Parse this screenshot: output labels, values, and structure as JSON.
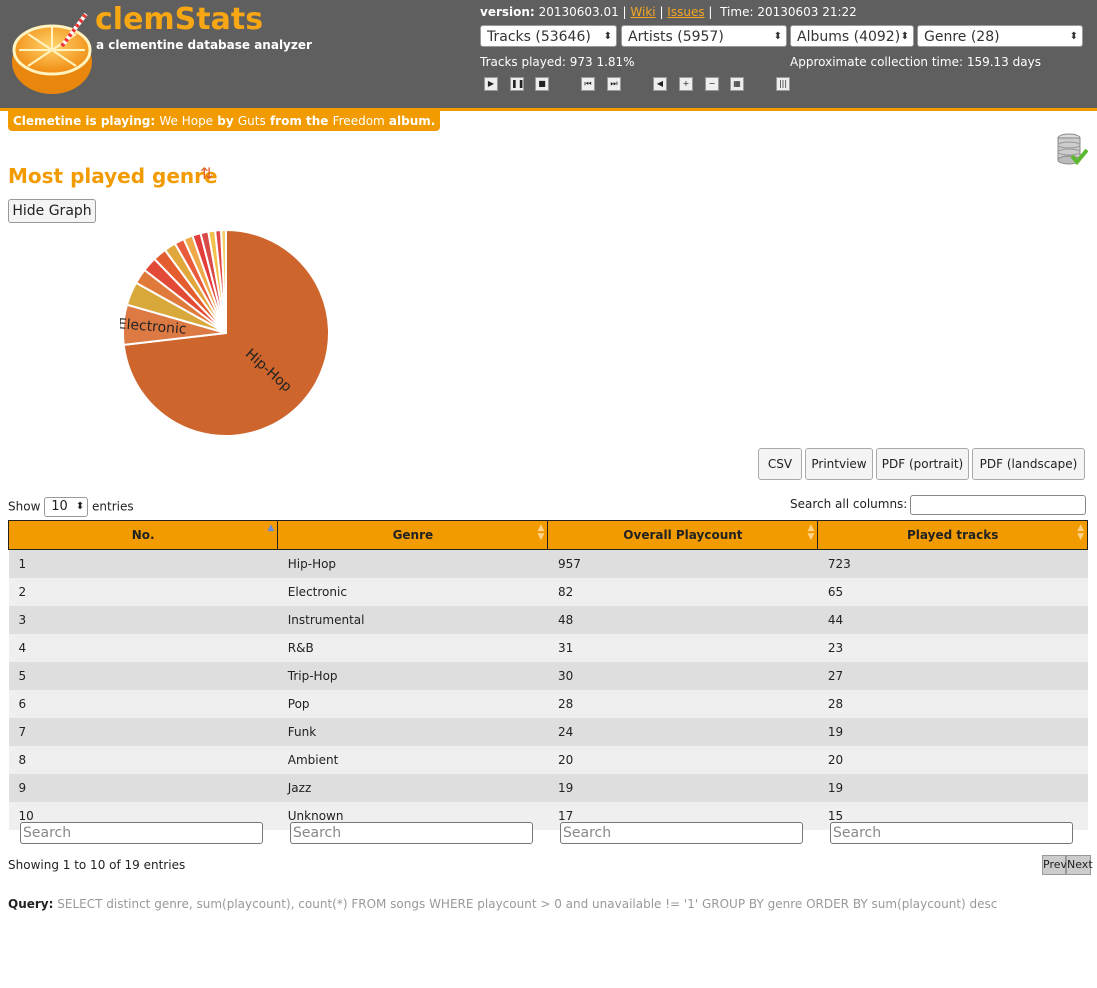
{
  "app": {
    "title": "clemStats",
    "subtitle": "a clementine database analyzer",
    "version_label": "version:",
    "version_value": "20130603.01",
    "wiki_link": "Wiki",
    "issues_link": "Issues",
    "time_label": "Time:",
    "time_value": "20130603 21:22"
  },
  "selectors": {
    "tracks": "Tracks (53646)",
    "artists": "Artists (5957)",
    "albums": "Albums (4092)",
    "genre": "Genre (28)"
  },
  "stats": {
    "tracks_played": "Tracks played: 973 1.81%",
    "collection_time": "Approximate collection time: 159.13 days"
  },
  "now_playing": {
    "prefix": "Clemetine is playing:",
    "track": "We Hope",
    "by": "by",
    "artist": "Guts",
    "from": "from the",
    "album": "Freedom",
    "suffix": "album."
  },
  "section": {
    "title": "Most played genre",
    "hide_graph": "Hide Graph"
  },
  "export_buttons": [
    "CSV",
    "Printview",
    "PDF (portrait)",
    "PDF (landscape)"
  ],
  "table_controls": {
    "show": "Show",
    "entries_count": "10",
    "entries": "entries",
    "search_all": "Search all columns:",
    "search_placeholder": "Search",
    "showing": "Showing 1 to 10 of 19 entries",
    "prev": "Prev",
    "next": "Next"
  },
  "columns": [
    "No.",
    "Genre",
    "Overall Playcount",
    "Played tracks"
  ],
  "rows": [
    [
      "1",
      "Hip-Hop",
      "957",
      "723"
    ],
    [
      "2",
      "Electronic",
      "82",
      "65"
    ],
    [
      "3",
      "Instrumental",
      "48",
      "44"
    ],
    [
      "4",
      "R&B",
      "31",
      "23"
    ],
    [
      "5",
      "Trip-Hop",
      "30",
      "27"
    ],
    [
      "6",
      "Pop",
      "28",
      "28"
    ],
    [
      "7",
      "Funk",
      "24",
      "19"
    ],
    [
      "8",
      "Ambient",
      "20",
      "20"
    ],
    [
      "9",
      "Jazz",
      "19",
      "19"
    ],
    [
      "10",
      "Unknown",
      "17",
      "15"
    ]
  ],
  "query": {
    "label": "Query:",
    "text": "SELECT distinct genre, sum(playcount), count(*) FROM songs WHERE playcount > 0 and unavailable != '1' GROUP BY genre ORDER BY sum(playcount) desc"
  },
  "chart_data": {
    "type": "pie",
    "slices": [
      {
        "label": "Hip-Hop",
        "value": 957
      },
      {
        "label": "Electronic",
        "value": 82
      },
      {
        "label": "",
        "value": 48
      },
      {
        "label": "",
        "value": 31
      },
      {
        "label": "",
        "value": 30
      },
      {
        "label": "",
        "value": 28
      },
      {
        "label": "",
        "value": 24
      },
      {
        "label": "",
        "value": 20
      },
      {
        "label": "",
        "value": 19
      },
      {
        "label": "",
        "value": 17
      },
      {
        "label": "",
        "value": 16
      },
      {
        "label": "",
        "value": 14
      },
      {
        "label": "",
        "value": 12
      },
      {
        "label": "",
        "value": 10
      }
    ],
    "colors": [
      "#cd652d",
      "#dd7a43",
      "#d9a83a",
      "#e07a3a",
      "#e24a37",
      "#e35d2e",
      "#e2a73b",
      "#e85c3b",
      "#f0a94a",
      "#e43b3b",
      "#d94b4b",
      "#f2c14e",
      "#e04848",
      "#f5d071"
    ]
  }
}
